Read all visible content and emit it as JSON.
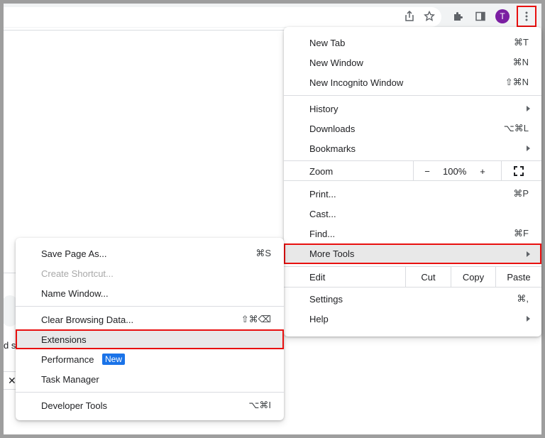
{
  "toolbar": {
    "avatar_letter": "T",
    "icons": [
      "share-icon",
      "star-icon",
      "extensions-icon",
      "side-panel-icon",
      "kebab-menu-icon"
    ]
  },
  "background": {
    "partial_text": "d s"
  },
  "main_menu": {
    "new_tab": {
      "label": "New Tab",
      "shortcut": "⌘T"
    },
    "new_window": {
      "label": "New Window",
      "shortcut": "⌘N"
    },
    "new_incognito": {
      "label": "New Incognito Window",
      "shortcut": "⇧⌘N"
    },
    "history": {
      "label": "History"
    },
    "downloads": {
      "label": "Downloads",
      "shortcut": "⌥⌘L"
    },
    "bookmarks": {
      "label": "Bookmarks"
    },
    "zoom": {
      "label": "Zoom",
      "minus": "−",
      "value": "100%",
      "plus": "+"
    },
    "print": {
      "label": "Print...",
      "shortcut": "⌘P"
    },
    "cast": {
      "label": "Cast..."
    },
    "find": {
      "label": "Find...",
      "shortcut": "⌘F"
    },
    "more_tools": {
      "label": "More Tools"
    },
    "edit": {
      "label": "Edit",
      "cut": "Cut",
      "copy": "Copy",
      "paste": "Paste"
    },
    "settings": {
      "label": "Settings",
      "shortcut": "⌘,"
    },
    "help": {
      "label": "Help"
    }
  },
  "sub_menu": {
    "save_page": {
      "label": "Save Page As...",
      "shortcut": "⌘S"
    },
    "create_shortcut": {
      "label": "Create Shortcut..."
    },
    "name_window": {
      "label": "Name Window..."
    },
    "clear_data": {
      "label": "Clear Browsing Data...",
      "shortcut": "⇧⌘⌫"
    },
    "extensions": {
      "label": "Extensions"
    },
    "performance": {
      "label": "Performance",
      "badge": "New"
    },
    "task_manager": {
      "label": "Task Manager"
    },
    "dev_tools": {
      "label": "Developer Tools",
      "shortcut": "⌥⌘I"
    }
  },
  "colors": {
    "highlight_outline": "#e8100f",
    "badge_blue": "#1a73e8",
    "avatar_purple": "#7b1fa2",
    "hover_gray": "#e8e8e8"
  }
}
